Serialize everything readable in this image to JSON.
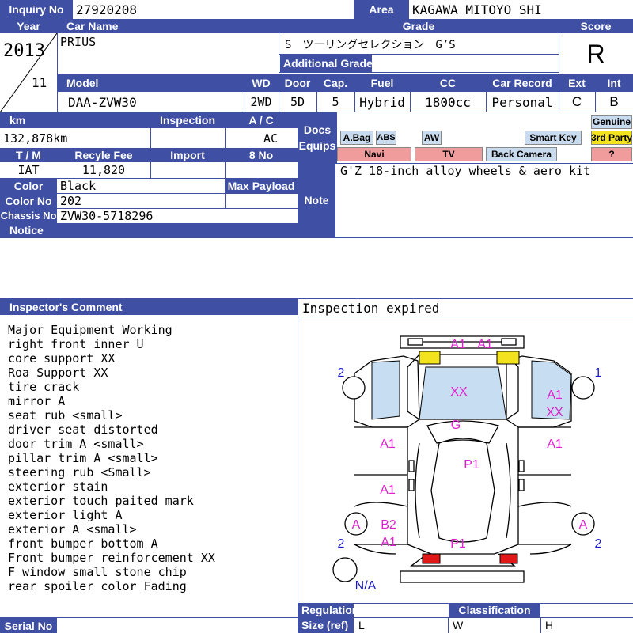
{
  "header": {
    "inquiry_label": "Inquiry No",
    "inquiry_no": "27920208",
    "area_label": "Area",
    "area": "KAGAWA MITOYO SHI"
  },
  "labels": {
    "year": "Year",
    "car_name": "Car Name",
    "grade": "Grade",
    "score": "Score",
    "additional_grade": "Additional Grade",
    "model": "Model",
    "wd": "WD",
    "door": "Door",
    "cap": "Cap.",
    "fuel": "Fuel",
    "cc": "CC",
    "car_record": "Car Record",
    "ext": "Ext",
    "int": "Int",
    "km": "km",
    "inspection": "Inspection",
    "ac": "A / C",
    "docs": "Docs",
    "equips": "Equips",
    "tm": "T / M",
    "recycle_fee": "Recyle Fee",
    "import": "Import",
    "eight_no": "8 No",
    "color": "Color",
    "max_payload": "Max Payload",
    "color_no": "Color No",
    "chassis_no": "Chassis No",
    "notice": "Notice",
    "note": "Note",
    "inspectors_comment": "Inspector's Comment",
    "serial_no": "Serial No",
    "regulation": "Regulation",
    "size_ref": "Size (ref)",
    "classification": "Classification"
  },
  "vehicle": {
    "year": "2013",
    "month": "11",
    "car_name": "PRIUS",
    "grade": "S　ツーリングセレクション　G’S",
    "score": "R",
    "model": "DAA-ZVW30",
    "wd": "2WD",
    "door": "5D",
    "cap": "5",
    "fuel": "Hybrid",
    "cc": "1800cc",
    "car_record": "Personal",
    "ext": "C",
    "int": "B",
    "km": "132,878km",
    "ac": "AC",
    "tm": "IAT",
    "recycle_fee": "11,820",
    "color": "Black",
    "color_no": "202",
    "chassis_no": "ZVW30-5718296"
  },
  "equips": {
    "abag": "A.Bag",
    "abs": "ABS",
    "aw": "AW",
    "smart_key": "Smart Key",
    "genuine": "Genuine",
    "third_party": "3rd Party",
    "navi": "Navi",
    "tv": "TV",
    "back_camera": "Back Camera",
    "question": "?"
  },
  "note_text": "G'Z 18-inch alloy wheels & aero kit",
  "inspection_status": "Inspection expired",
  "comments": [
    "Major Equipment Working",
    "right front inner U",
    "core support XX",
    "Roa Support XX",
    "tire crack",
    "mirror A",
    "seat rub <small>",
    "driver seat distorted",
    "door trim A <small>",
    "pillar trim A <small>",
    "steering rub <Small>",
    "exterior stain",
    "exterior touch paited mark",
    "exterior light A",
    "exterior A <small>",
    "front bumper bottom A",
    "Front bumper reinforcement XX",
    "F window small stone chip",
    "rear spoiler color Fading"
  ],
  "size_ref": {
    "l": "L",
    "w": "W",
    "h": "H"
  },
  "diagram": {
    "marks": {
      "front_bumper_1": "A1",
      "front_bumper_2": "A1",
      "windshield": "XX",
      "left_num_top": "2",
      "right_num_top": "1",
      "right_fender_1": "A1",
      "right_fender_2": "XX",
      "hood_g": "G",
      "left_front_door": "A1",
      "right_front_door": "A1",
      "roof": "P1",
      "left_rear_door": "A1",
      "left_rear_wheel": "A",
      "right_rear_wheel": "A",
      "left_rear_b2": "B2",
      "left_rear_a1": "A1",
      "rear_p1": "P1",
      "left_num_bottom": "2",
      "right_num_bottom": "2",
      "spare": "N/A"
    },
    "colors": {
      "mark": "#e020d0",
      "num": "#1a1acc",
      "glass": "#c7def2",
      "light_front": "#f2e31e",
      "light_rear": "#e01818"
    }
  }
}
